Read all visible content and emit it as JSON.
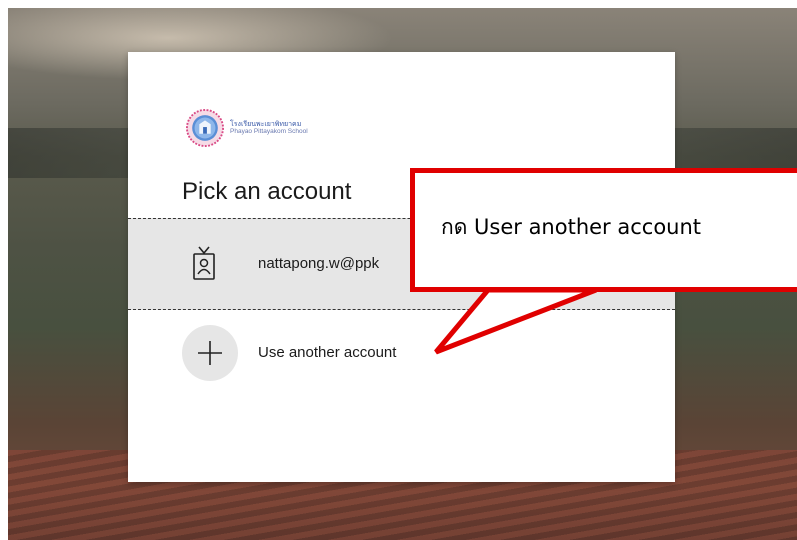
{
  "login": {
    "logo": {
      "name_th": "โรงเรียนพะเยาพิทยาคม",
      "name_en": "Phayao Pittayakom School",
      "icon": "school-seal-icon"
    },
    "title": "Pick an account",
    "accounts": [
      {
        "email": "nattapong.w@ppk",
        "icon": "badge-person-icon"
      }
    ],
    "use_another": {
      "label": "Use another account",
      "icon": "plus-icon"
    }
  },
  "annotation": {
    "text": "กด User another account",
    "border_color": "#e00000"
  }
}
